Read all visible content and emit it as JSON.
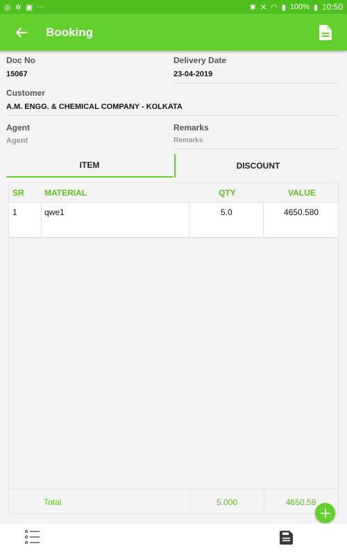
{
  "status_bar": {
    "battery": "100%",
    "time": "10:50"
  },
  "app_bar": {
    "title": "Booking",
    "back_icon": "arrow-left-icon",
    "action_icon": "document-icon"
  },
  "header": {
    "doc_no_label": "Doc No",
    "doc_no_value": "15067",
    "delivery_date_label": "Delivery Date",
    "delivery_date_value": "23-04-2019",
    "customer_label": "Customer",
    "customer_value": "A.M. ENGG. & CHEMICAL COMPANY - KOLKATA",
    "agent_label": "Agent",
    "agent_placeholder": "Agent",
    "remarks_label": "Remarks",
    "remarks_placeholder": "Remarks"
  },
  "tabs": [
    {
      "label": "ITEM",
      "active": true
    },
    {
      "label": "DISCOUNT",
      "active": false
    }
  ],
  "table": {
    "columns": [
      "SR",
      "MATERIAL",
      "QTY",
      "VALUE"
    ],
    "rows": [
      {
        "sr": "1",
        "material": "qwe1",
        "qty": "5.0",
        "value": "4650.580"
      }
    ],
    "footer": {
      "label": "Total",
      "qty": "5.000",
      "value": "4650.58"
    }
  },
  "bottom_bar": {
    "left_icon": "list-icon",
    "right_icon": "save-icon"
  },
  "colors": {
    "primary": "#63cf2c",
    "status_bar": "#4ebf1e",
    "accent_text": "#5ac226"
  }
}
